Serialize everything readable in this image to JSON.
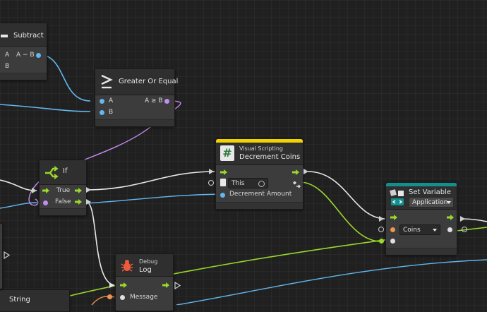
{
  "colors": {
    "canvas": "#202020",
    "blue": "#63b7ee",
    "purple": "#c58cf0",
    "flow_white": "#e8e8e8",
    "flow_green": "#9ad82a",
    "unity_yellow": "#f4d200",
    "teal": "#12908e"
  },
  "nodes": {
    "subtract": {
      "title": "Subtract",
      "port_a": "A",
      "port_b": "B",
      "output": "A − B",
      "icon": "minus-icon"
    },
    "greater_or_equal": {
      "title": "Greater Or Equal",
      "port_a": "A",
      "port_b": "B",
      "output": "A ≥ B",
      "icon": "greater-equal-icon"
    },
    "if": {
      "title": "If",
      "true_label": "True",
      "false_label": "False",
      "icon": "branch-icon"
    },
    "decrement_coins": {
      "category": "Visual Scripting",
      "title": "Decrement Coins",
      "this_value": "This",
      "amount_label": "Decrement Amount",
      "icon": "hash-icon"
    },
    "set_variable": {
      "title": "Set Variable",
      "scope": "Application",
      "variable": "Coins",
      "icon": "variable-icon"
    },
    "debug_log": {
      "category": "Debug",
      "title": "Log",
      "message_label": "Message",
      "icon": "bug-icon"
    },
    "string": {
      "title": "String"
    }
  }
}
